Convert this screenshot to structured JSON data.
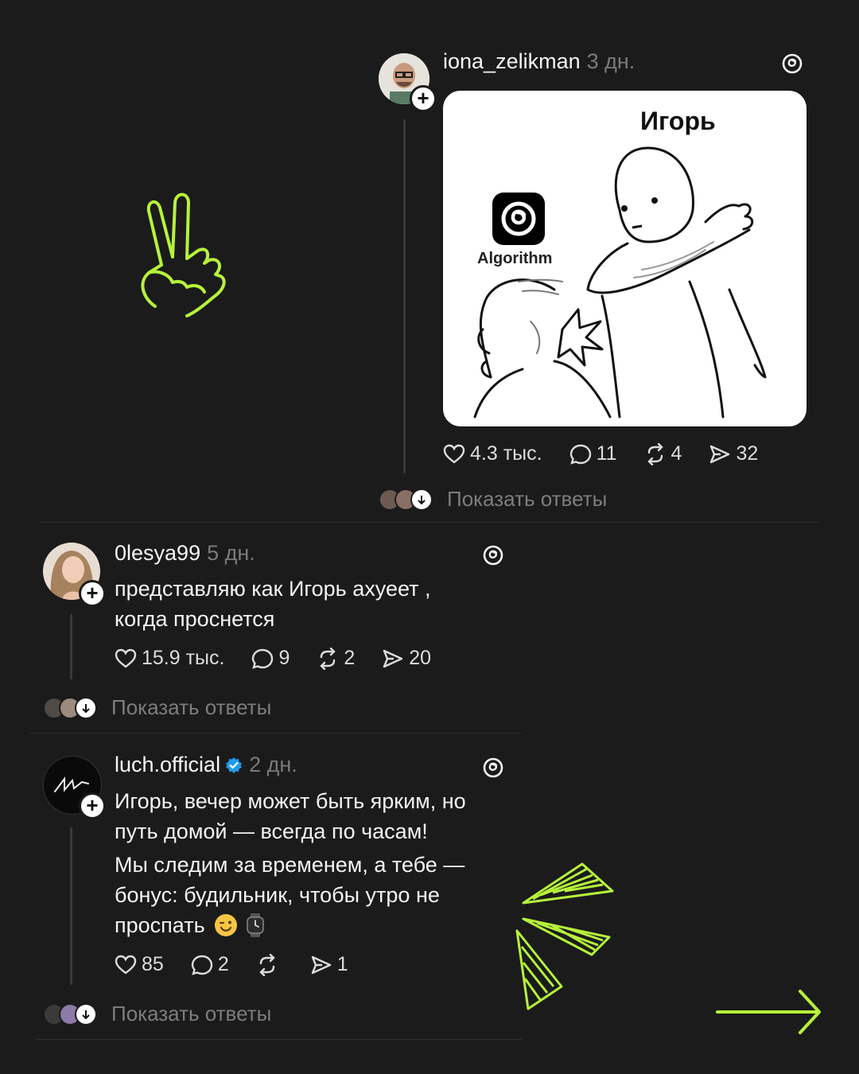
{
  "posts": [
    {
      "handle": "iona_zelikman",
      "time": "3 дн.",
      "meme": {
        "top_label": "Игорь",
        "left_label": "Algorithm"
      },
      "likes": "4.3 тыс.",
      "comments": "11",
      "reposts": "4",
      "shares": "32",
      "show_replies": "Показать ответы"
    },
    {
      "handle": "0lesya99",
      "time": "5 дн.",
      "text_line1": "представляю как Игорь ахуеет ,",
      "text_line2": "когда проснется",
      "likes": "15.9 тыс.",
      "comments": "9",
      "reposts": "2",
      "shares": "20",
      "show_replies": "Показать ответы"
    },
    {
      "handle": "luch.official",
      "time": "2 дн.",
      "verified": true,
      "text_line1": "Игорь, вечер может быть ярким, но",
      "text_line2": "путь домой — всегда по часам!",
      "text_line3": "Мы следим за временем, а тебе —",
      "text_line4": "бонус: будильник, чтобы утро не",
      "text_line5": "проспать",
      "likes": "85",
      "comments": "2",
      "reposts": "",
      "shares": "1",
      "show_replies": "Показать ответы"
    }
  ],
  "colors": {
    "background": "#1b1b1b",
    "accent": "#b6f23a",
    "verified": "#1d9bf0",
    "muted": "#7d7d7d"
  },
  "icons": [
    "threads-icon",
    "heart-icon",
    "comment-icon",
    "repost-icon",
    "share-icon",
    "plus-icon",
    "arrow-down-icon",
    "verified-badge-icon",
    "victory-hand-doodle",
    "arrow-right-doodle",
    "triangle-burst-doodle"
  ]
}
